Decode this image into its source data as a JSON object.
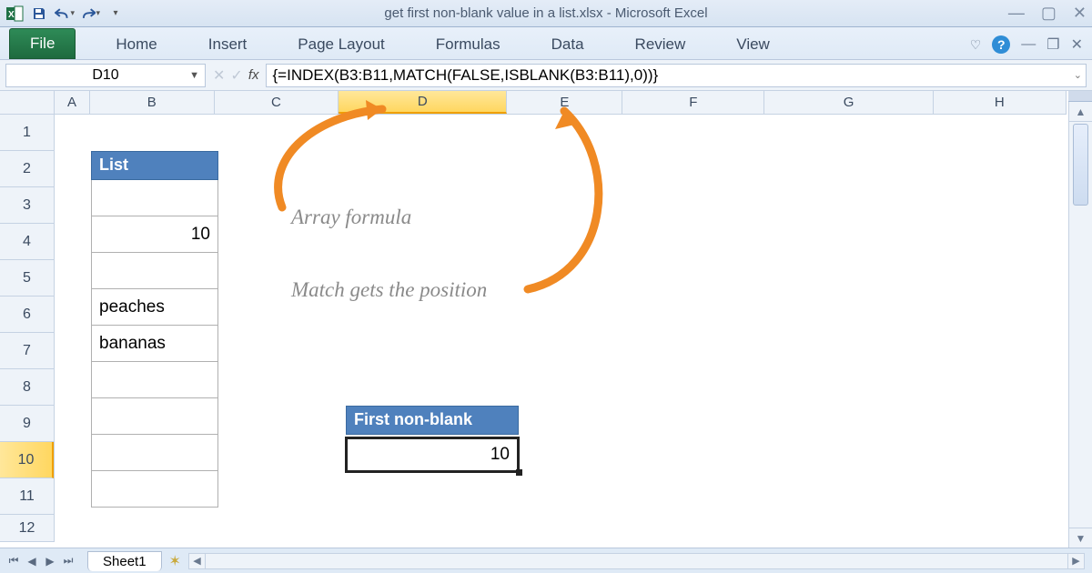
{
  "window": {
    "title": "get first non-blank value in a list.xlsx  -  Microsoft Excel"
  },
  "qat": {
    "save": "save",
    "undo": "undo",
    "redo": "redo"
  },
  "ribbon": {
    "file": "File",
    "tabs": [
      "Home",
      "Insert",
      "Page Layout",
      "Formulas",
      "Data",
      "Review",
      "View"
    ]
  },
  "fbar": {
    "namebox": "D10",
    "fx": "fx",
    "formula": "{=INDEX(B3:B11,MATCH(FALSE,ISBLANK(B3:B11),0))}"
  },
  "columns": [
    "A",
    "B",
    "C",
    "D",
    "E",
    "F",
    "G",
    "H"
  ],
  "rows": [
    "1",
    "2",
    "3",
    "4",
    "5",
    "6",
    "7",
    "8",
    "9",
    "10",
    "11",
    "12"
  ],
  "selected": {
    "col": "D",
    "row": "10"
  },
  "list": {
    "header": "List",
    "items": [
      "",
      "10",
      "",
      "peaches",
      "bananas",
      "",
      "",
      "",
      ""
    ]
  },
  "result": {
    "header": "First non-blank",
    "value": "10"
  },
  "annotations": {
    "a1": "Array formula",
    "a2": "Match gets the position"
  },
  "sheetbar": {
    "sheet": "Sheet1"
  }
}
